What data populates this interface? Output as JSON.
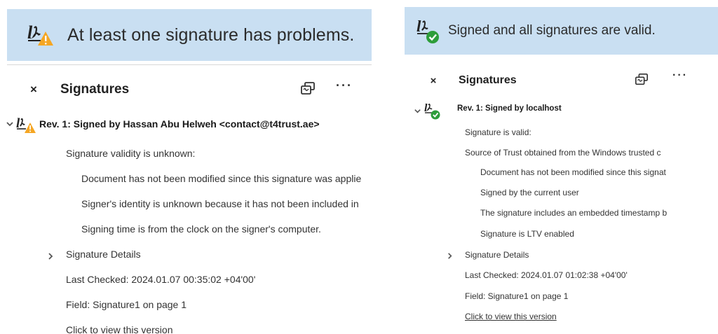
{
  "left": {
    "banner_text": "At least one signature has problems.",
    "panel_title": "Signatures",
    "close_glyph": "×",
    "more_glyph": "···",
    "rev_title": "Rev. 1: Signed by Hassan Abu Helweh <contact@t4trust.ae>",
    "status": "Signature validity is unknown:",
    "details": [
      "Document has not been modified since this signature was applie",
      "Signer's identity is unknown because it has not been included in",
      "Signing time is from the clock on the signer's computer."
    ],
    "signature_details_label": "Signature Details",
    "last_checked": "Last Checked: 2024.01.07 00:35:02 +04'00'",
    "field": "Field: Signature1 on page 1",
    "click_to_view": "Click to view this version",
    "badge_icon": "warning-icon",
    "badge_color": "#f5a623"
  },
  "right": {
    "banner_text": "Signed and all signatures are valid.",
    "panel_title": "Signatures",
    "close_glyph": "×",
    "more_glyph": "···",
    "rev_title": "Rev. 1: Signed by localhost",
    "status": "Signature is valid:",
    "trust_source": "Source of Trust obtained from the Windows trusted c",
    "details": [
      "Document has not been modified since this signat",
      "Signed by the current user",
      "The signature includes an embedded timestamp b",
      "Signature is LTV enabled"
    ],
    "signature_details_label": "Signature Details",
    "last_checked": "Last Checked: 2024.01.07 01:02:38 +04'00'",
    "field": "Field: Signature1 on page 1",
    "click_to_view": "Click to view this version",
    "badge_icon": "checkmark-icon",
    "badge_color": "#2d9d3a"
  },
  "colors": {
    "banner_bg": "#c9dff2",
    "text": "#2c2c2c"
  }
}
